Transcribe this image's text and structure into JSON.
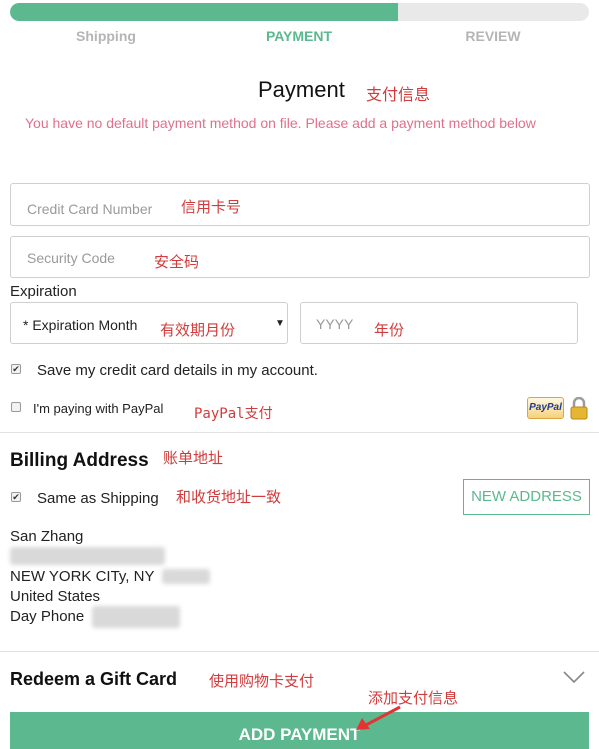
{
  "progress": {
    "percent": 67
  },
  "steps": [
    {
      "label": "Shipping",
      "active": false
    },
    {
      "label": "PAYMENT",
      "active": true
    },
    {
      "label": "REVIEW",
      "active": false
    }
  ],
  "payment": {
    "title": "Payment",
    "title_note": "支付信息",
    "warning": "You have no default payment method on file. Please add a payment method below",
    "card_number": {
      "placeholder": "Credit Card Number",
      "note": "信用卡号"
    },
    "security_code": {
      "placeholder": "Security Code",
      "note": "安全码"
    },
    "expiration_label": "Expiration",
    "expiration_month": {
      "selected": "* Expiration Month",
      "note": "有效期月份"
    },
    "expiration_year": {
      "placeholder": "YYYY",
      "note": "年份"
    },
    "save_card_label": "Save my credit card details in my account.",
    "save_card_checked": true,
    "paypal_label": "I'm paying with PayPal",
    "paypal_checked": false,
    "paypal_note": "PayPal支付",
    "paypal_logo": "PayPal"
  },
  "billing": {
    "title": "Billing Address",
    "title_note": "账单地址",
    "same_as_shipping_label": "Same as Shipping",
    "same_as_shipping_checked": true,
    "same_note": "和收货地址一致",
    "new_address_button": "NEW ADDRESS",
    "address": {
      "name": "San Zhang",
      "city_line": "NEW YORK CITy, NY",
      "country": "United States",
      "phone_label": "Day Phone"
    }
  },
  "gift_card": {
    "title": "Redeem a Gift Card",
    "note": "使用购物卡支付"
  },
  "add_payment": {
    "label": "ADD PAYMENT",
    "note": "添加支付信息"
  },
  "colors": {
    "accent": "#5cb88e",
    "warning": "#e0708c",
    "annotation": "#d23b3b"
  }
}
